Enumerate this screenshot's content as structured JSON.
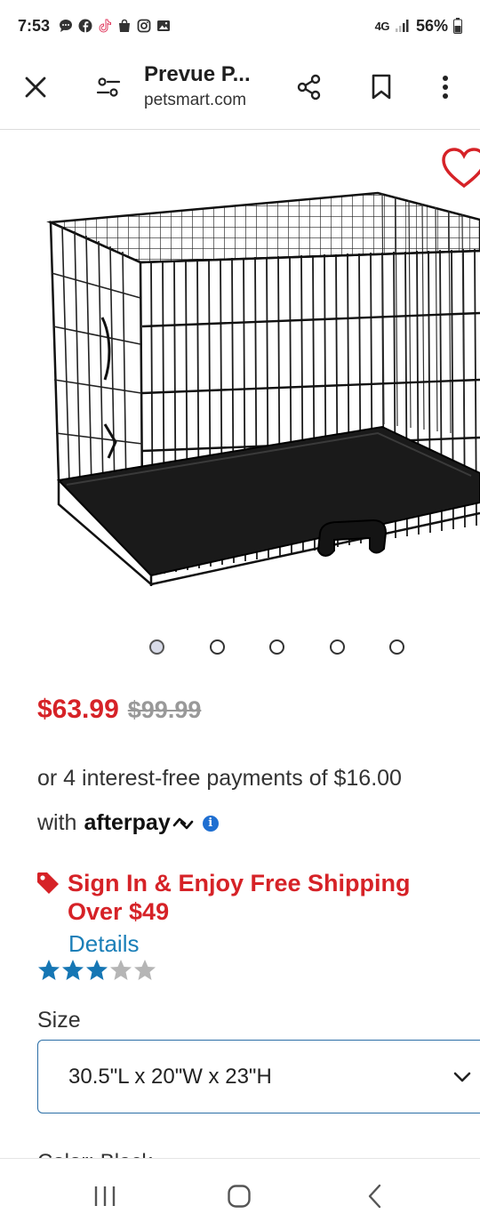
{
  "status_bar": {
    "time": "7:53",
    "network": "4G",
    "battery": "56%",
    "icons": [
      "chat-icon",
      "facebook-icon",
      "tiktok-icon",
      "shopping-bag-icon",
      "instagram-icon",
      "gallery-icon"
    ]
  },
  "app_bar": {
    "title": "Prevue P...",
    "url": "petsmart.com",
    "icons": [
      "close-icon",
      "site-settings-icon",
      "share-icon",
      "bookmark-icon",
      "more-icon"
    ]
  },
  "product": {
    "image_alt": "black wire dog crate with plastic tray and handle",
    "favorite_icon": "heart-icon",
    "carousel": {
      "count": 5,
      "active_index": 0
    },
    "price": "$63.99",
    "original_price": "$99.99",
    "afterpay": {
      "line1": "or 4 interest-free payments of $16.00",
      "prefix": "with",
      "brand": "afterpay",
      "info": "i"
    },
    "shipping_promo": "Sign In & Enjoy Free Shipping Over $49",
    "details_link": "Details",
    "rating": {
      "value": 3,
      "max": 5
    },
    "size_label": "Size",
    "size_value": "30.5\"L x 20\"W x 23\"H",
    "color_label_partial": "Color: Black"
  },
  "colors": {
    "price_red": "#d62227",
    "link_blue": "#1b7fb8",
    "star_blue": "#1576b4",
    "star_grey": "#b5b5b5",
    "select_border": "#2b6ea6"
  },
  "nav_bar": {
    "icons": [
      "recent-apps-icon",
      "home-icon",
      "back-icon"
    ]
  }
}
